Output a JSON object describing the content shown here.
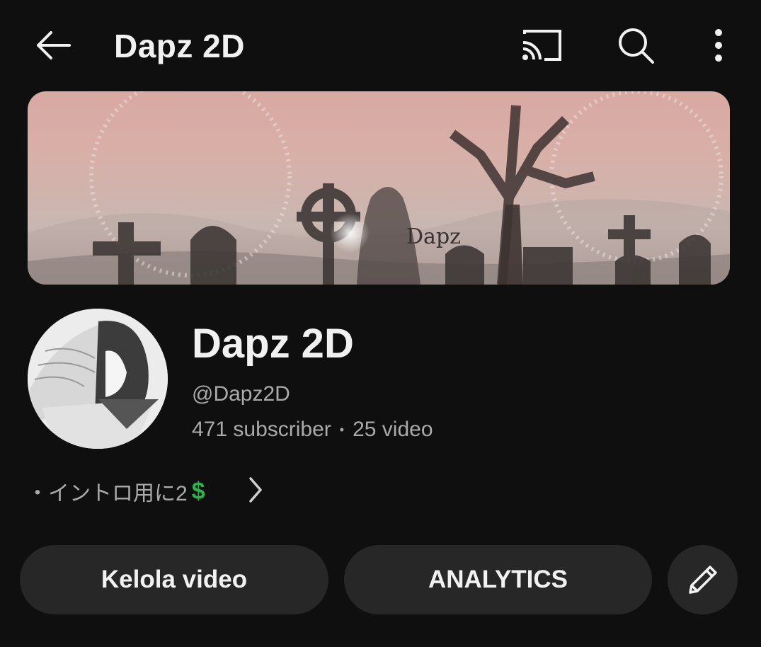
{
  "topbar": {
    "title": "Dapz 2D",
    "icons": [
      "back-arrow-icon",
      "cast-icon",
      "search-icon",
      "more-vertical-icon"
    ]
  },
  "banner": {
    "watermark": "Dapz"
  },
  "channel": {
    "name": "Dapz 2D",
    "handle": "@Dapz2D",
    "subscribers": "471 subscriber",
    "separator": "•",
    "videos": "25 video"
  },
  "description": {
    "text": "・イントロ用に2",
    "emoji": "$"
  },
  "actions": {
    "manage_label": "Kelola video",
    "analytics_label": "ANALYTICS"
  },
  "colors": {
    "background": "#0f0f0f",
    "button_bg": "#272727",
    "secondary_text": "#aaaaaa",
    "dollar_green": "#2bb24c"
  }
}
